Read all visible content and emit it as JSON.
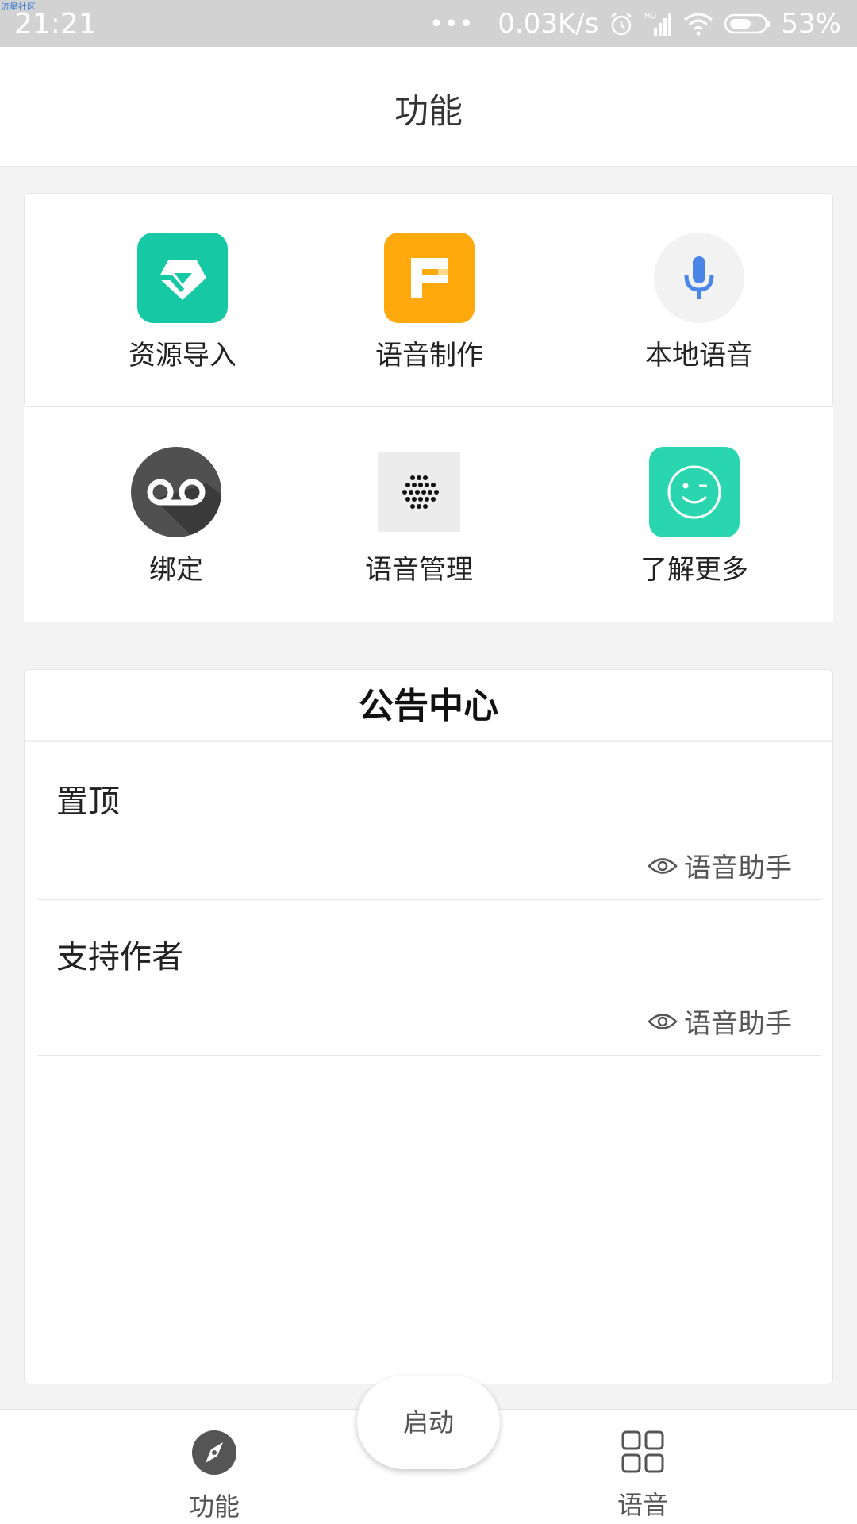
{
  "status_bar": {
    "watermark": "流星社区",
    "time": "21:21",
    "dots": "•••",
    "speed": "0.03K/s",
    "battery": "53%"
  },
  "header": {
    "title": "功能"
  },
  "features": [
    {
      "label": "资源导入",
      "icon": "resource-import-icon"
    },
    {
      "label": "语音制作",
      "icon": "voice-make-icon"
    },
    {
      "label": "本地语音",
      "icon": "microphone-icon"
    },
    {
      "label": "绑定",
      "icon": "voicemail-icon"
    },
    {
      "label": "语音管理",
      "icon": "dot-grid-icon"
    },
    {
      "label": "了解更多",
      "icon": "wink-face-icon"
    }
  ],
  "notice": {
    "title": "公告中心",
    "items": [
      {
        "title": "置顶",
        "author": "语音助手"
      },
      {
        "title": "支持作者",
        "author": "语音助手"
      }
    ]
  },
  "bottom_nav": {
    "tabs": [
      {
        "label": "功能",
        "icon": "compass-icon"
      },
      {
        "label": "语音",
        "icon": "grid-icon"
      }
    ],
    "fab_label": "启动"
  },
  "colors": {
    "resource_green": "#17c8a5",
    "make_orange": "#ffa90d",
    "mic_blue": "#4a86e8",
    "more_teal": "#2ad6b0"
  }
}
